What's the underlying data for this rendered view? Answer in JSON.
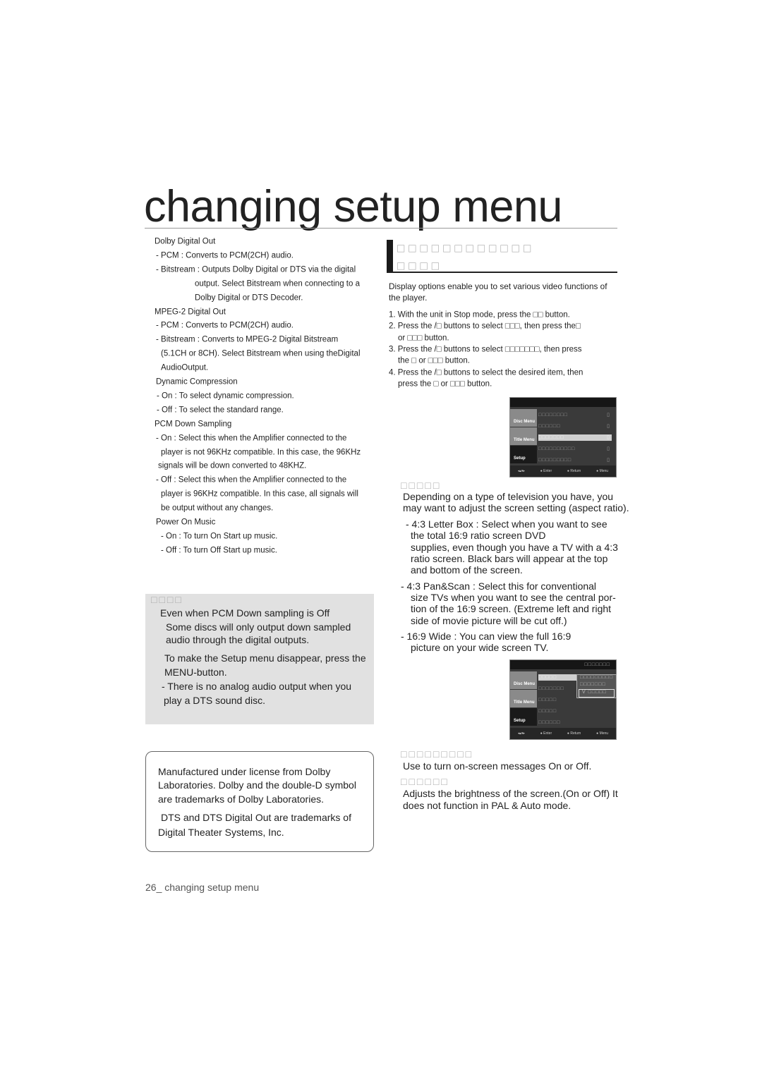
{
  "page_title": "changing setup menu",
  "left_column": [
    "Dolby Digital Out",
    "- PCM : Converts to PCM(2CH) audio.",
    "- Bitstream : Outputs Dolby Digital or DTS via the digital",
    "output. Select Bitstream when connecting to a",
    "Dolby Digital or DTS Decoder.",
    "MPEG-2 Digital Out",
    "- PCM : Converts to PCM(2CH) audio.",
    "- Bitstream : Converts to MPEG-2 Digital Bitstream",
    "(5.1CH or 8CH). Select Bitstream when using theDigital",
    "AudioOutput.",
    "Dynamic Compression",
    "- On : To select dynamic compression.",
    "- Off : To select the standard range.",
    "PCM Down Sampling",
    "- On : Select this when the Amplifier connected to the",
    "player is not 96KHz compatible. In this case, the 96KHz",
    "signals will be down converted to 48KHZ.",
    "- Off : Select this when the Amplifier connected to the",
    "player is 96KHz compatible. In this case, all signals will",
    "be output without any changes.",
    "Power On Music",
    "- On : To turn On Start up music.",
    "- Off : To turn Off Start up music."
  ],
  "note": {
    "heading": "□□□□",
    "lines": [
      "Even when PCM Down sampling is Off",
      "Some discs will only output down sampled",
      "audio through the digital outputs.",
      "To make the Setup menu disappear, press the",
      "MENU-button.",
      "- There is no analog audio output when you",
      "play a DTS sound disc."
    ]
  },
  "license": [
    "Manufactured under license from Dolby",
    "Laboratories.  Dolby  and the double-D symbol",
    "are trademarks of Dolby Laboratories.",
    " DTS  and  DTS Digital Out  are trademarks of",
    "Digital Theater Systems, Inc."
  ],
  "section": {
    "heading_line1": "□□□□□□□□□□□□",
    "heading_line2": "□□□□",
    "intro": [
      "Display options enable you to set various video functions of",
      "the player."
    ],
    "steps": [
      "1. With the unit in Stop mode, press the □□ button.",
      "2. Press the   /□   buttons to select □□□, then press the□",
      "or □□□ button.",
      "3. Press the   /□   buttons to select □□□□□□□, then press",
      "the □  or □□□  button.",
      "4. Press the   /□   buttons to select the desired item, then",
      "press the □  or □□□  button."
    ],
    "aspect": {
      "heading": "□□□□□",
      "lines": [
        "Depending on a type of television you have, you",
        "may want to adjust the screen setting (aspect ratio).",
        "- 4:3 Letter Box : Select when you want to see",
        "the total 16:9 ratio screen DVD",
        "supplies, even though you have a TV with a 4:3",
        "ratio screen. Black bars will appear at the top",
        "and bottom of the screen.",
        "- 4:3 Pan&Scan : Select this for conventional",
        "size TVs when you want to see the central por-",
        "tion of the 16:9 screen. (Extreme left and right",
        "side of movie picture will be cut off.)",
        "- 16:9 Wide : You can view the full 16:9",
        "picture on your wide screen TV."
      ]
    },
    "osd_heading": "□□□□□□□□□",
    "osd_text": "Use to turn on-screen messages On or Off.",
    "black_heading": "□□□□□□",
    "black_lines": [
      "Adjusts the brightness of the screen.(On or Off) It",
      "does not function in PAL & Auto mode."
    ]
  },
  "screens": [
    {
      "header": "",
      "tabs": [
        "Disc Menu",
        "Title Menu",
        "Setup"
      ],
      "rows": [
        "□□□□□□□□",
        "□□□□□□",
        "□□□□□□□",
        "□□□□□□□□□□",
        "□□□□□□□□□"
      ],
      "footer": [
        "Enter",
        "Return",
        "Menu"
      ]
    },
    {
      "header": "□□□□□□□",
      "tabs": [
        "Disc Menu",
        "Title Menu",
        "Setup"
      ],
      "rows": [
        "□□□□□",
        "□□□□□□□",
        "□□□□□",
        "□□□□□",
        "□□□□□□"
      ],
      "popup": [
        "□□□□□□□□□",
        "□□□□□□□",
        "V □□□□□"
      ],
      "footer": [
        "Enter",
        "Return",
        "Menu"
      ]
    }
  ],
  "footer": "26_ changing setup menu"
}
